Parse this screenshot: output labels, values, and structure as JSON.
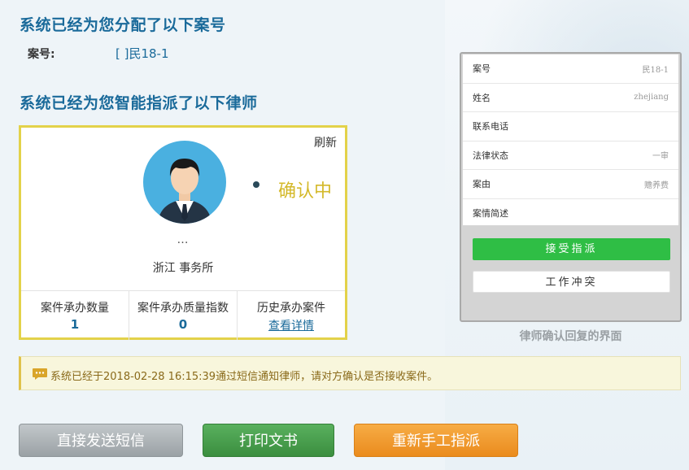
{
  "assign": {
    "title": "系统已经为您分配了以下案号",
    "case_label": "案号:",
    "case_value": "[    ]民18-1"
  },
  "lawyer": {
    "title": "系统已经为您智能指派了以下律师",
    "refresh": "刷新",
    "status": "确认中",
    "name": "…",
    "firm": "浙江       事务所",
    "stats": [
      {
        "label": "案件承办数量",
        "value": "1"
      },
      {
        "label": "案件承办质量指数",
        "value": "0"
      },
      {
        "label": "历史承办案件",
        "link": "查看详情"
      }
    ]
  },
  "phone": {
    "rows": [
      {
        "key": "案号",
        "value": "民18-1"
      },
      {
        "key": "姓名",
        "value": "zhejiang"
      },
      {
        "key": "联系电话",
        "value": ""
      },
      {
        "key": "法律状态",
        "value": "一审"
      },
      {
        "key": "案由",
        "value": "赡养费"
      },
      {
        "key": "案情简述",
        "value": ""
      }
    ],
    "accept": "接受指派",
    "conflict": "工作冲突",
    "caption": "律师确认回复的界面"
  },
  "notice": {
    "text": "系统已经于2018-02-28  16:15:39通过短信通知律师，请对方确认是否接收案件。"
  },
  "buttons": {
    "send_sms": "直接发送短信",
    "print": "打印文书",
    "reassign": "重新手工指派"
  }
}
